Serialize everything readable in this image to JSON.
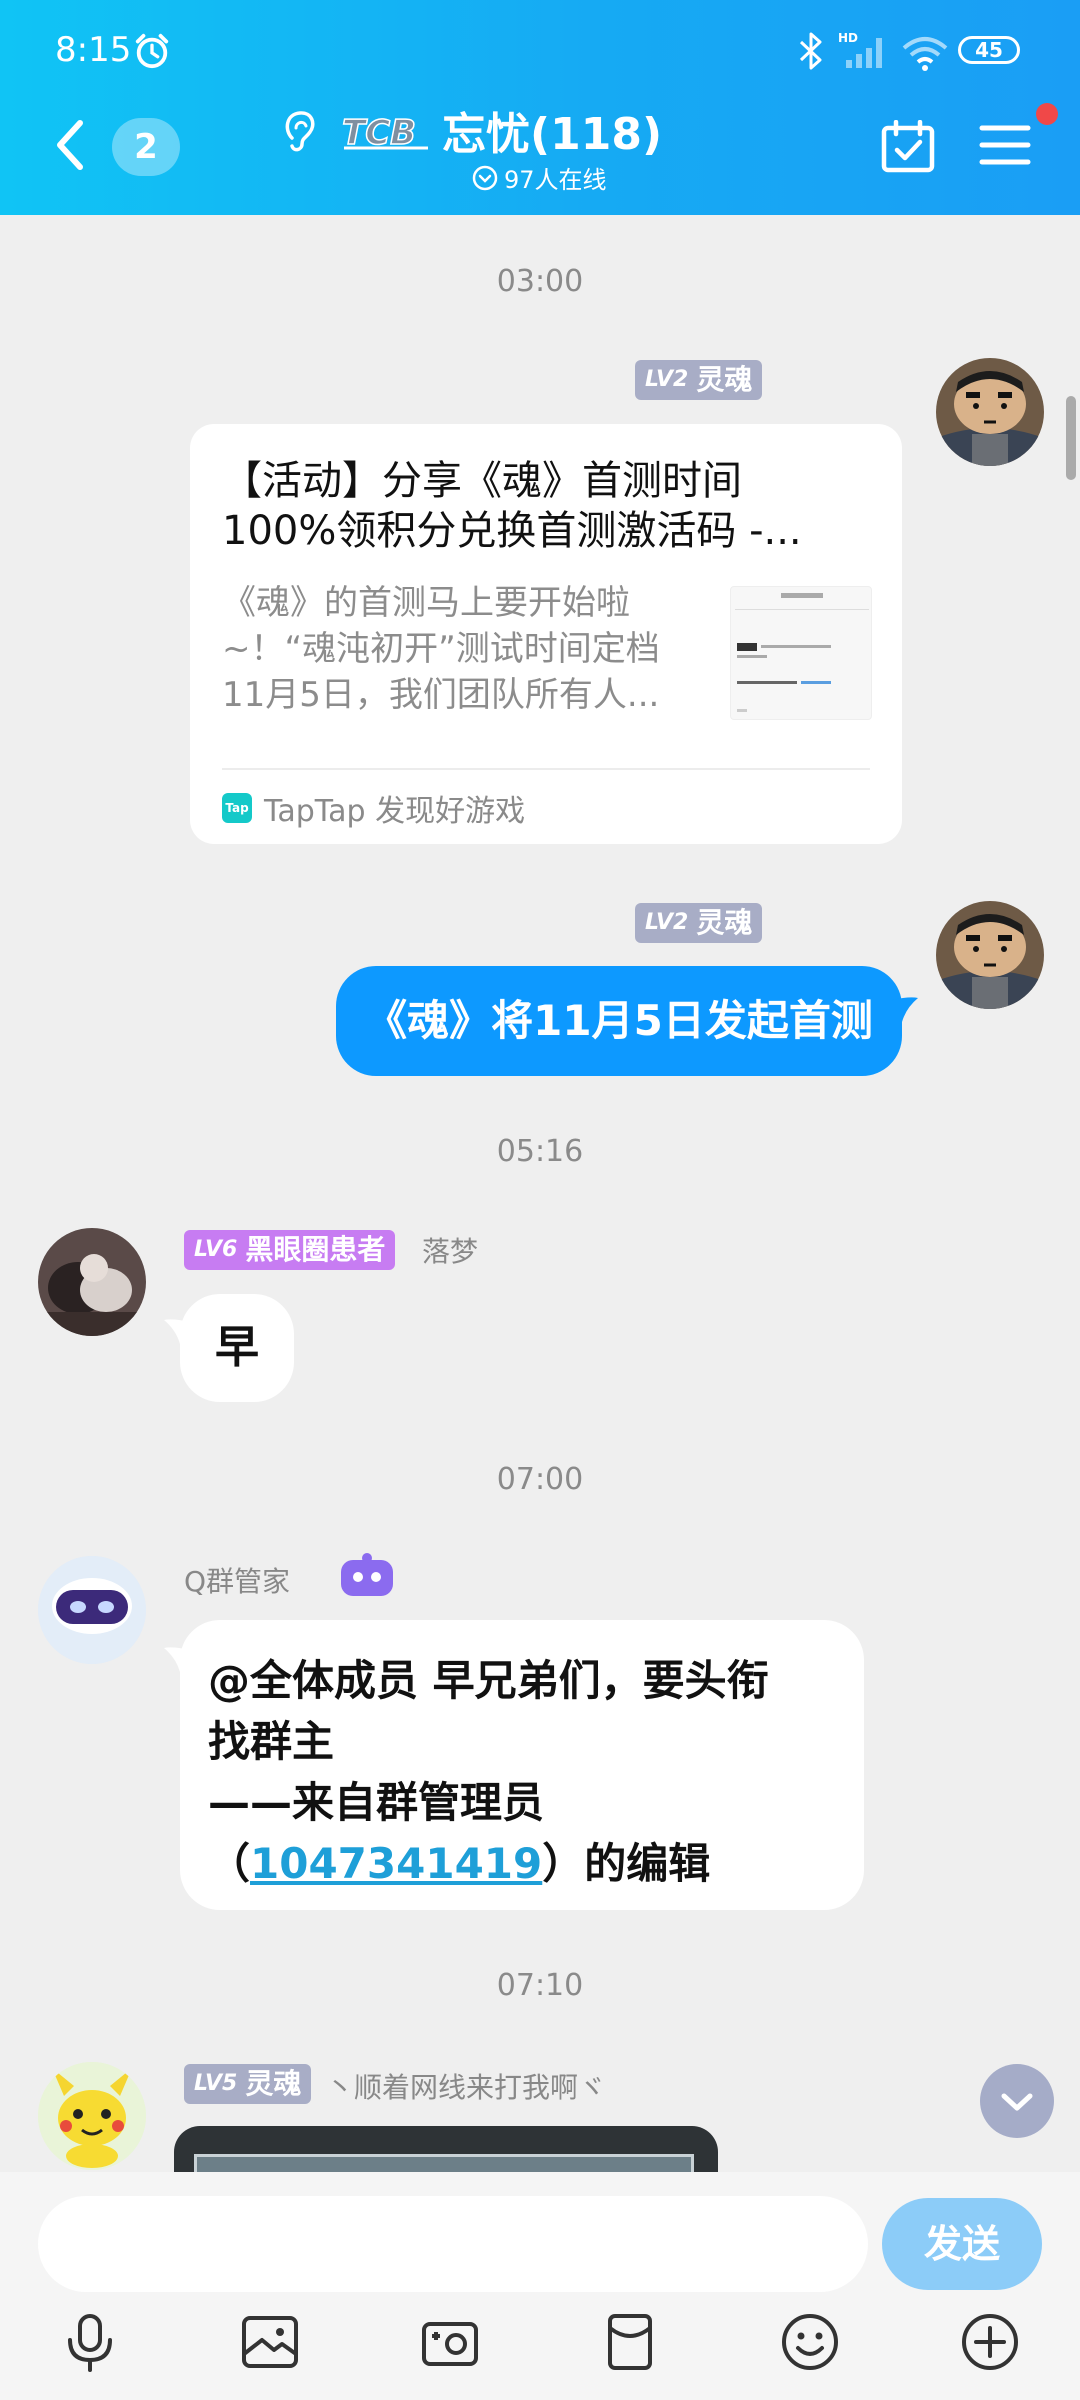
{
  "status_bar": {
    "time": "8:15",
    "battery": "45",
    "hd": "HD"
  },
  "header": {
    "unread_count": "2",
    "group_name": "忘忧(118)",
    "logo_text": "TCB",
    "online": "97人在线"
  },
  "chat": {
    "time_1": "03:00",
    "sender_tag_1": {
      "lv": "LV2",
      "title": "灵魂"
    },
    "card": {
      "title_line1": "【活动】分享《魂》首测时间",
      "title_line2": "100%领积分兑换首测激活码 -...",
      "desc_line1": "《魂》的首测马上要开始啦",
      "desc_line2": "~！“魂沌初开”测试时间定档",
      "desc_line3": "11月5日，我们团队所有人...",
      "source": "TapTap 发现好游戏"
    },
    "sender_tag_2": {
      "lv": "LV2",
      "title": "灵魂"
    },
    "bubble_blue": "《魂》将11月5日发起首测",
    "time_2": "05:16",
    "msg_luomeng": {
      "lv": "LV6",
      "title": "黑眼圈患者",
      "nick": "落梦",
      "text": "早"
    },
    "time_3": "07:00",
    "bot": {
      "nick": "Q群管家",
      "line1": "@全体成员 早兄弟们，要头衔",
      "line2": "找群主",
      "line3": "——来自群管理员",
      "line4_pre": "（",
      "line4_link": "1047341419",
      "line4_post": "）的编辑"
    },
    "time_4": "07:10",
    "msg_pikachu": {
      "lv": "LV5",
      "title": "灵魂",
      "nick": "丶顺着网线来打我啊ヾ"
    }
  },
  "input": {
    "placeholder": "",
    "send_label": "发送"
  },
  "colors": {
    "header_blue": "#16aaf3",
    "bubble_blue": "#0d99ff",
    "send_disabled": "#8cccf8",
    "lv_tag_gray": "#a8adc6",
    "lv6_purple": "#c77cf2"
  }
}
